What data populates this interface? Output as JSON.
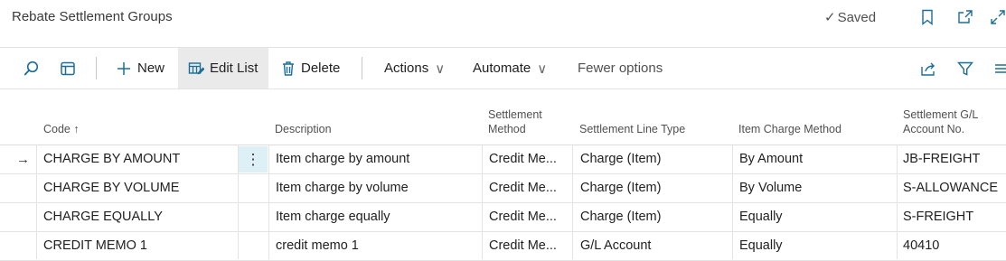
{
  "page": {
    "title": "Rebate Settlement Groups",
    "saved_label": "Saved",
    "saved_check": "✓"
  },
  "toolbar": {
    "new_label": "New",
    "edit_list_label": "Edit List",
    "delete_label": "Delete",
    "actions_label": "Actions",
    "automate_label": "Automate",
    "fewer_options_label": "Fewer options",
    "chevron": "∨"
  },
  "table": {
    "columns": {
      "code": "Code",
      "code_sort": "↑",
      "description": "Description",
      "settlement_method_1": "Settlement",
      "settlement_method_2": "Method",
      "settlement_line_type": "Settlement Line Type",
      "item_charge_method": "Item Charge Method",
      "gl_account_1": "Settlement G/L",
      "gl_account_2": "Account No."
    },
    "rows": [
      {
        "code": "CHARGE BY AMOUNT",
        "description": "Item charge by amount",
        "method": "Credit Me...",
        "line_type": "Charge (Item)",
        "item_charge": "By Amount",
        "gl": "JB-FREIGHT"
      },
      {
        "code": "CHARGE BY VOLUME",
        "description": "Item charge by volume",
        "method": "Credit Me...",
        "line_type": "Charge (Item)",
        "item_charge": "By Volume",
        "gl": "S-ALLOWANCE"
      },
      {
        "code": "CHARGE EQUALLY",
        "description": "Item charge equally",
        "method": "Credit Me...",
        "line_type": "Charge (Item)",
        "item_charge": "Equally",
        "gl": "S-FREIGHT"
      },
      {
        "code": "CREDIT MEMO 1",
        "description": "credit memo 1",
        "method": "Credit Me...",
        "line_type": "G/L Account",
        "item_charge": "Equally",
        "gl": "40410"
      }
    ],
    "selected_row_marker": "→",
    "row_menu": "⋮"
  },
  "colors": {
    "accent": "#1a6e97",
    "active_button_bg": "#eaeaea",
    "row_menu_bg": "#dcf0f5"
  }
}
